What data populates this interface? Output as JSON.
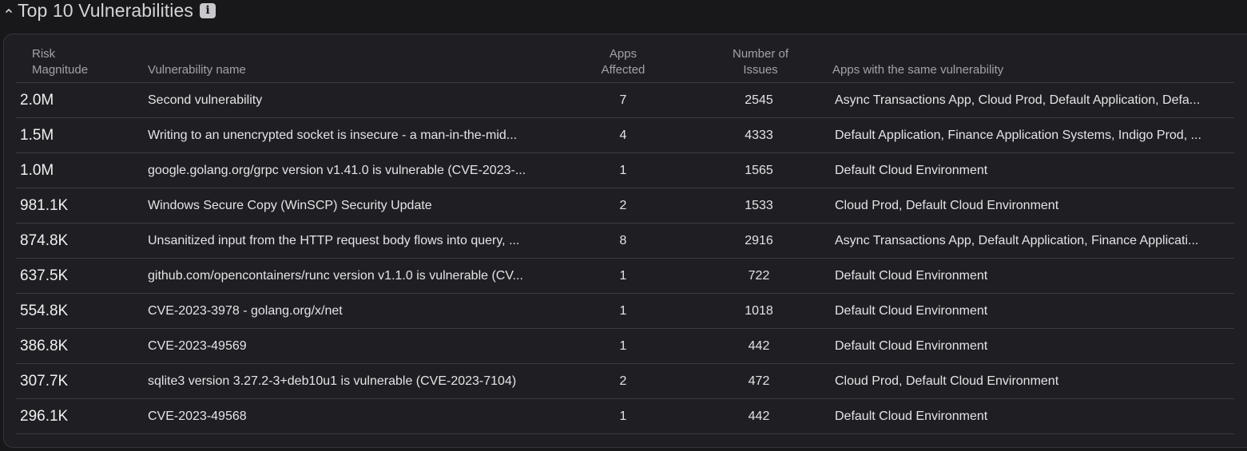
{
  "section": {
    "title": "Top 10 Vulnerabilities",
    "info_icon": "info-icon",
    "toggle_icon": "chevron-up-icon"
  },
  "columns": {
    "risk_line1": "Risk",
    "risk_line2": "Magnitude",
    "name": "Vulnerability name",
    "apps_line1": "Apps",
    "apps_line2": "Affected",
    "issues_line1": "Number of",
    "issues_line2": "Issues",
    "same": "Apps with the same vulnerability"
  },
  "rows": [
    {
      "risk": "2.0M",
      "name": "Second vulnerability",
      "apps": "7",
      "issues": "2545",
      "same": "Async Transactions App, Cloud Prod, Default Application, Defa..."
    },
    {
      "risk": "1.5M",
      "name": "Writing to an unencrypted socket is insecure - a man-in-the-mid...",
      "apps": "4",
      "issues": "4333",
      "same": "Default Application, Finance Application Systems, Indigo Prod, ..."
    },
    {
      "risk": "1.0M",
      "name": "google.golang.org/grpc version v1.41.0 is vulnerable (CVE-2023-...",
      "apps": "1",
      "issues": "1565",
      "same": "Default Cloud Environment"
    },
    {
      "risk": "981.1K",
      "name": "Windows Secure Copy (WinSCP) Security Update",
      "apps": "2",
      "issues": "1533",
      "same": "Cloud Prod, Default Cloud Environment"
    },
    {
      "risk": "874.8K",
      "name": "Unsanitized input from the HTTP request body flows into query, ...",
      "apps": "8",
      "issues": "2916",
      "same": "Async Transactions App, Default Application, Finance Applicati..."
    },
    {
      "risk": "637.5K",
      "name": "github.com/opencontainers/runc version v1.1.0 is vulnerable (CV...",
      "apps": "1",
      "issues": "722",
      "same": "Default Cloud Environment"
    },
    {
      "risk": "554.8K",
      "name": "CVE-2023-3978 - golang.org/x/net",
      "apps": "1",
      "issues": "1018",
      "same": "Default Cloud Environment"
    },
    {
      "risk": "386.8K",
      "name": "CVE-2023-49569",
      "apps": "1",
      "issues": "442",
      "same": "Default Cloud Environment"
    },
    {
      "risk": "307.7K",
      "name": "sqlite3 version 3.27.2-3+deb10u1 is vulnerable (CVE-2023-7104)",
      "apps": "2",
      "issues": "472",
      "same": "Cloud Prod, Default Cloud Environment"
    },
    {
      "risk": "296.1K",
      "name": "CVE-2023-49568",
      "apps": "1",
      "issues": "442",
      "same": "Default Cloud Environment"
    }
  ]
}
